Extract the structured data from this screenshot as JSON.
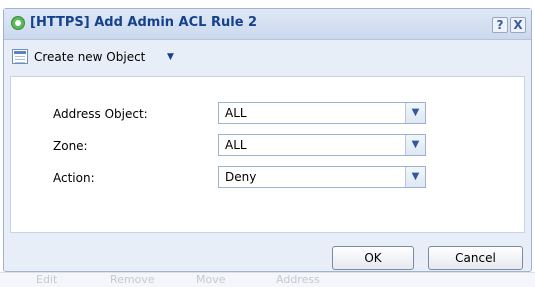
{
  "background": {
    "toolbar_items": [
      "Edit",
      "Remove",
      "Move"
    ],
    "column_header": "Address"
  },
  "dialog": {
    "title": "[HTTPS] Add Admin ACL Rule 2",
    "help_button": "?",
    "close_button": "X",
    "create_label": "Create new Object",
    "fields": {
      "address_object": {
        "label": "Address Object:",
        "value": "ALL"
      },
      "zone": {
        "label": "Zone:",
        "value": "ALL"
      },
      "action": {
        "label": "Action:",
        "value": "Deny"
      }
    },
    "ok_label": "OK",
    "cancel_label": "Cancel"
  },
  "icons": {
    "title": "add-circle-icon",
    "create": "create-object-icon",
    "dropdown": "chevron-down-icon"
  },
  "colors": {
    "title_text": "#15428b",
    "dialog_bg": "#e8eef7"
  }
}
